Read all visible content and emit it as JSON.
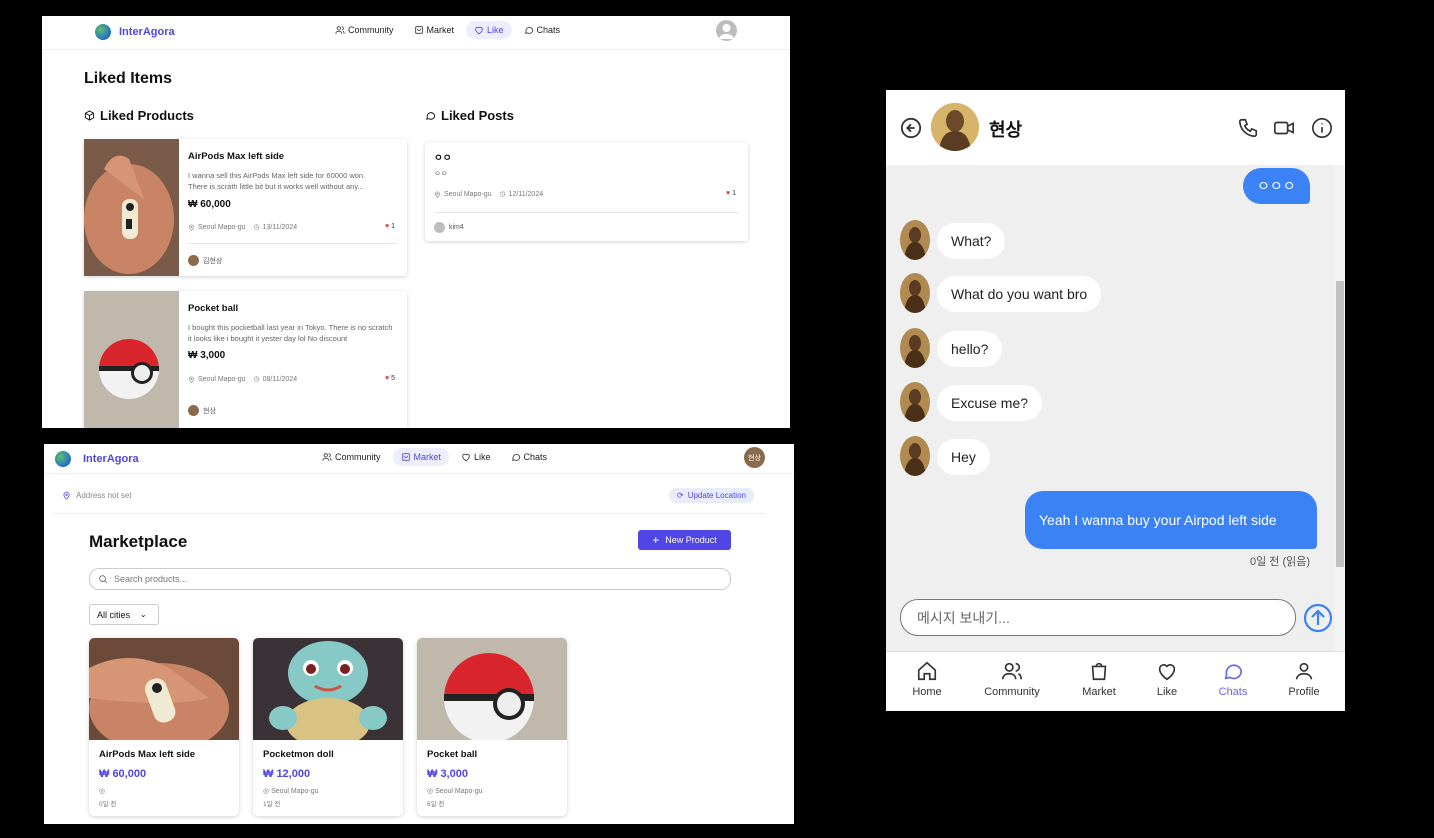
{
  "brand": {
    "name": "InterAgora"
  },
  "nav": {
    "community": "Community",
    "market": "Market",
    "like": "Like",
    "chats": "Chats"
  },
  "liked": {
    "title": "Liked Items",
    "products_heading": "Liked Products",
    "posts_heading": "Liked Posts",
    "products": [
      {
        "title": "AirPods Max left side",
        "desc": "I wanna sell this AirPods Max left side for 60000 won. There is scrath little bit but it works well without any...",
        "price": "₩ 60,000",
        "location": "Seoul Mapo-gu",
        "date": "13/11/2024",
        "likes": "1",
        "seller": "김현상"
      },
      {
        "title": "Pocket ball",
        "desc": "I bought this pocketball last year in Tokyo. There is no scratch it looks like i bought it yester day lol No discount",
        "price": "₩ 3,000",
        "location": "Seoul Mapo-gu",
        "date": "08/11/2024",
        "likes": "5",
        "seller": "현상"
      }
    ],
    "posts": [
      {
        "title": "ㅇㅇ",
        "body": "ㅇㅇ",
        "location": "Seoul Mapo-gu",
        "date": "12/11/2024",
        "likes": "1",
        "author": "kim4"
      }
    ]
  },
  "market": {
    "address": "Address not set",
    "update_location": "Update Location",
    "title": "Marketplace",
    "new_product": "New Product",
    "search_placeholder": "Search products...",
    "city_filter": "All cities",
    "avatar_label": "현상",
    "items": [
      {
        "name": "AirPods Max left side",
        "price": "₩ 60,000",
        "location": "",
        "time": "0일 전"
      },
      {
        "name": "Pocketmon doll",
        "price": "₩ 12,000",
        "location": "Seoul Mapo-gu",
        "time": "1일 전"
      },
      {
        "name": "Pocket ball",
        "price": "₩ 3,000",
        "location": "Seoul Mapo-gu",
        "time": "6일 전"
      }
    ]
  },
  "chat": {
    "partner": "현상",
    "messages": [
      {
        "from": "me",
        "text": "ㅇㅇㅇ"
      },
      {
        "from": "them",
        "text": "What?"
      },
      {
        "from": "them",
        "text": "What do you want bro"
      },
      {
        "from": "them",
        "text": "hello?"
      },
      {
        "from": "them",
        "text": "Excuse me?"
      },
      {
        "from": "them",
        "text": "Hey"
      },
      {
        "from": "me",
        "text": "Yeah I wanna buy your Airpod left side"
      }
    ],
    "read_status": "0일 전 (읽음)",
    "input_placeholder": "메시지 보내기...",
    "tabs": [
      "Home",
      "Community",
      "Market",
      "Like",
      "Chats",
      "Profile"
    ]
  },
  "colors": {
    "accent": "#4f46e5",
    "bubble_out": "#3b82f6",
    "chat_bg": "#efefef",
    "like_heart": "#e53935"
  }
}
